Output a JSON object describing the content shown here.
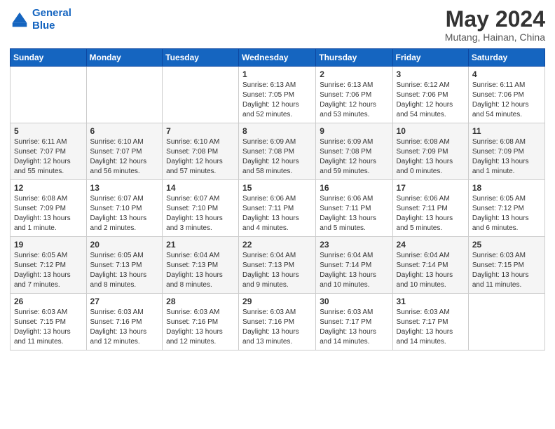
{
  "header": {
    "logo_line1": "General",
    "logo_line2": "Blue",
    "month_title": "May 2024",
    "location": "Mutang, Hainan, China"
  },
  "days_of_week": [
    "Sunday",
    "Monday",
    "Tuesday",
    "Wednesday",
    "Thursday",
    "Friday",
    "Saturday"
  ],
  "weeks": [
    [
      {
        "day": "",
        "info": ""
      },
      {
        "day": "",
        "info": ""
      },
      {
        "day": "",
        "info": ""
      },
      {
        "day": "1",
        "info": "Sunrise: 6:13 AM\nSunset: 7:05 PM\nDaylight: 12 hours\nand 52 minutes."
      },
      {
        "day": "2",
        "info": "Sunrise: 6:13 AM\nSunset: 7:06 PM\nDaylight: 12 hours\nand 53 minutes."
      },
      {
        "day": "3",
        "info": "Sunrise: 6:12 AM\nSunset: 7:06 PM\nDaylight: 12 hours\nand 54 minutes."
      },
      {
        "day": "4",
        "info": "Sunrise: 6:11 AM\nSunset: 7:06 PM\nDaylight: 12 hours\nand 54 minutes."
      }
    ],
    [
      {
        "day": "5",
        "info": "Sunrise: 6:11 AM\nSunset: 7:07 PM\nDaylight: 12 hours\nand 55 minutes."
      },
      {
        "day": "6",
        "info": "Sunrise: 6:10 AM\nSunset: 7:07 PM\nDaylight: 12 hours\nand 56 minutes."
      },
      {
        "day": "7",
        "info": "Sunrise: 6:10 AM\nSunset: 7:08 PM\nDaylight: 12 hours\nand 57 minutes."
      },
      {
        "day": "8",
        "info": "Sunrise: 6:09 AM\nSunset: 7:08 PM\nDaylight: 12 hours\nand 58 minutes."
      },
      {
        "day": "9",
        "info": "Sunrise: 6:09 AM\nSunset: 7:08 PM\nDaylight: 12 hours\nand 59 minutes."
      },
      {
        "day": "10",
        "info": "Sunrise: 6:08 AM\nSunset: 7:09 PM\nDaylight: 13 hours\nand 0 minutes."
      },
      {
        "day": "11",
        "info": "Sunrise: 6:08 AM\nSunset: 7:09 PM\nDaylight: 13 hours\nand 1 minute."
      }
    ],
    [
      {
        "day": "12",
        "info": "Sunrise: 6:08 AM\nSunset: 7:09 PM\nDaylight: 13 hours\nand 1 minute."
      },
      {
        "day": "13",
        "info": "Sunrise: 6:07 AM\nSunset: 7:10 PM\nDaylight: 13 hours\nand 2 minutes."
      },
      {
        "day": "14",
        "info": "Sunrise: 6:07 AM\nSunset: 7:10 PM\nDaylight: 13 hours\nand 3 minutes."
      },
      {
        "day": "15",
        "info": "Sunrise: 6:06 AM\nSunset: 7:11 PM\nDaylight: 13 hours\nand 4 minutes."
      },
      {
        "day": "16",
        "info": "Sunrise: 6:06 AM\nSunset: 7:11 PM\nDaylight: 13 hours\nand 5 minutes."
      },
      {
        "day": "17",
        "info": "Sunrise: 6:06 AM\nSunset: 7:11 PM\nDaylight: 13 hours\nand 5 minutes."
      },
      {
        "day": "18",
        "info": "Sunrise: 6:05 AM\nSunset: 7:12 PM\nDaylight: 13 hours\nand 6 minutes."
      }
    ],
    [
      {
        "day": "19",
        "info": "Sunrise: 6:05 AM\nSunset: 7:12 PM\nDaylight: 13 hours\nand 7 minutes."
      },
      {
        "day": "20",
        "info": "Sunrise: 6:05 AM\nSunset: 7:13 PM\nDaylight: 13 hours\nand 8 minutes."
      },
      {
        "day": "21",
        "info": "Sunrise: 6:04 AM\nSunset: 7:13 PM\nDaylight: 13 hours\nand 8 minutes."
      },
      {
        "day": "22",
        "info": "Sunrise: 6:04 AM\nSunset: 7:13 PM\nDaylight: 13 hours\nand 9 minutes."
      },
      {
        "day": "23",
        "info": "Sunrise: 6:04 AM\nSunset: 7:14 PM\nDaylight: 13 hours\nand 10 minutes."
      },
      {
        "day": "24",
        "info": "Sunrise: 6:04 AM\nSunset: 7:14 PM\nDaylight: 13 hours\nand 10 minutes."
      },
      {
        "day": "25",
        "info": "Sunrise: 6:03 AM\nSunset: 7:15 PM\nDaylight: 13 hours\nand 11 minutes."
      }
    ],
    [
      {
        "day": "26",
        "info": "Sunrise: 6:03 AM\nSunset: 7:15 PM\nDaylight: 13 hours\nand 11 minutes."
      },
      {
        "day": "27",
        "info": "Sunrise: 6:03 AM\nSunset: 7:16 PM\nDaylight: 13 hours\nand 12 minutes."
      },
      {
        "day": "28",
        "info": "Sunrise: 6:03 AM\nSunset: 7:16 PM\nDaylight: 13 hours\nand 12 minutes."
      },
      {
        "day": "29",
        "info": "Sunrise: 6:03 AM\nSunset: 7:16 PM\nDaylight: 13 hours\nand 13 minutes."
      },
      {
        "day": "30",
        "info": "Sunrise: 6:03 AM\nSunset: 7:17 PM\nDaylight: 13 hours\nand 14 minutes."
      },
      {
        "day": "31",
        "info": "Sunrise: 6:03 AM\nSunset: 7:17 PM\nDaylight: 13 hours\nand 14 minutes."
      },
      {
        "day": "",
        "info": ""
      }
    ]
  ]
}
